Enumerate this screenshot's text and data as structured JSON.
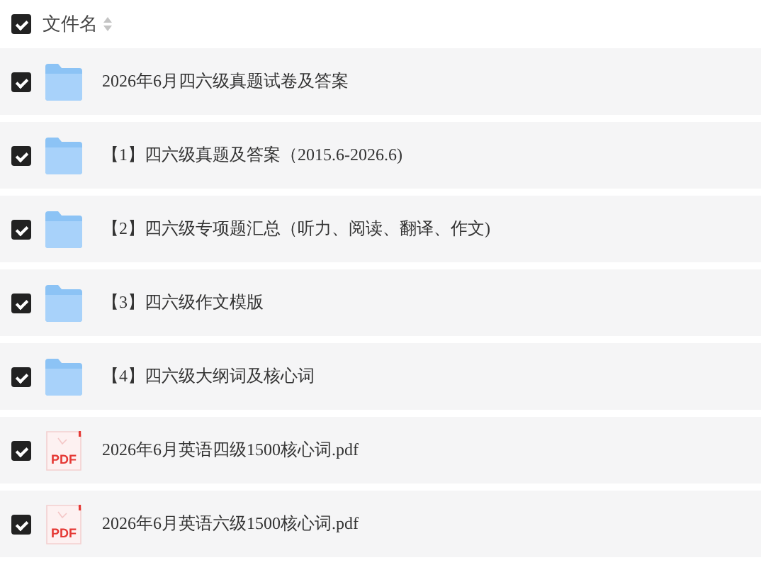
{
  "header": {
    "checked": true,
    "column_label": "文件名"
  },
  "files": [
    {
      "kind": "folder",
      "name": "2026年6月四六级真题试卷及答案",
      "checked": true
    },
    {
      "kind": "folder",
      "name": "【1】四六级真题及答案（2015.6-2026.6)",
      "checked": true
    },
    {
      "kind": "folder",
      "name": "【2】四六级专项题汇总（听力、阅读、翻译、作文)",
      "checked": true
    },
    {
      "kind": "folder",
      "name": "【3】四六级作文模版",
      "checked": true
    },
    {
      "kind": "folder",
      "name": "【4】四六级大纲词及核心词",
      "checked": true
    },
    {
      "kind": "pdf",
      "type_label": "PDF",
      "name": "2026年6月英语四级1500核心词.pdf",
      "checked": true
    },
    {
      "kind": "pdf",
      "type_label": "PDF",
      "name": "2026年6月英语六级1500核心词.pdf",
      "checked": true
    }
  ]
}
